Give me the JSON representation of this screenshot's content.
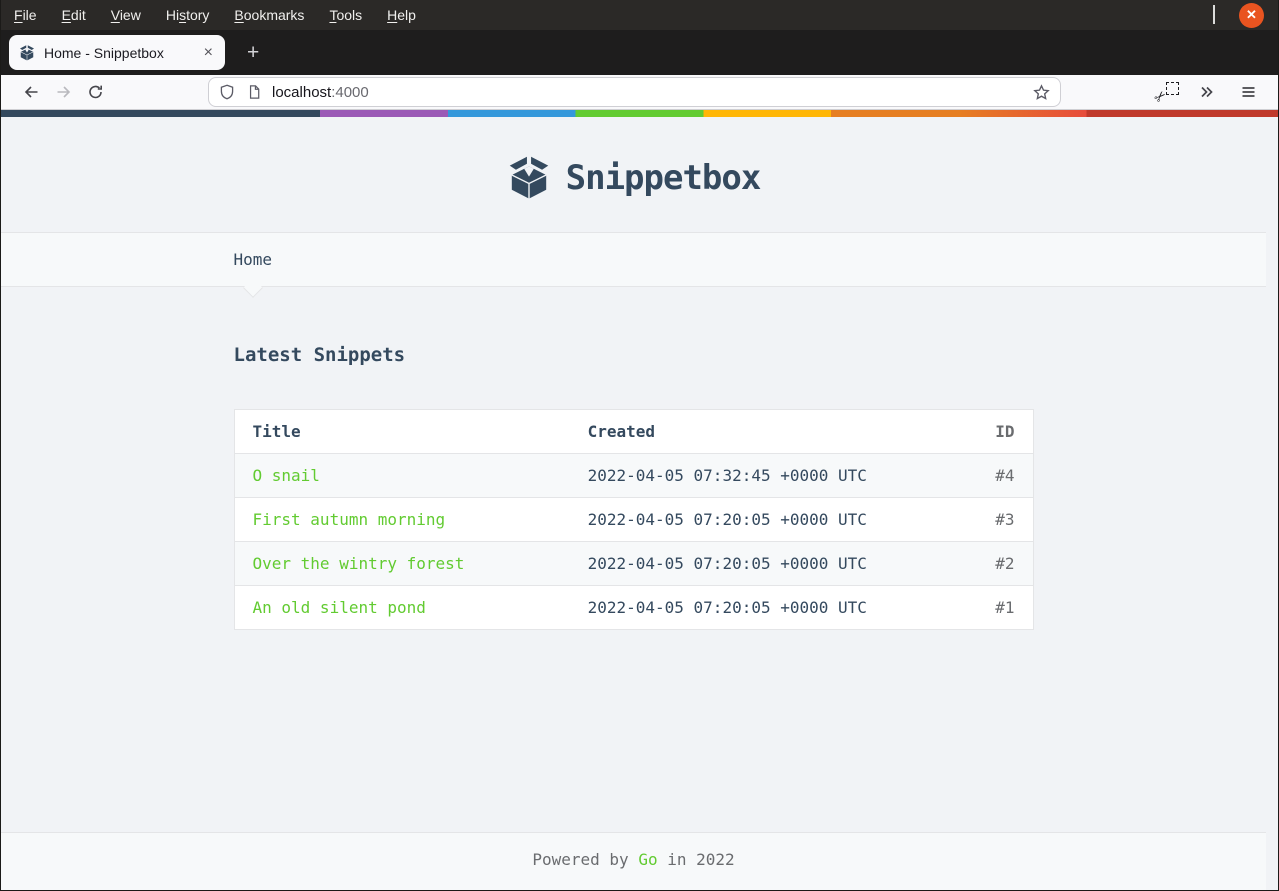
{
  "menubar": {
    "items": [
      {
        "pre": "",
        "key": "F",
        "post": "ile"
      },
      {
        "pre": "",
        "key": "E",
        "post": "dit"
      },
      {
        "pre": "",
        "key": "V",
        "post": "iew"
      },
      {
        "pre": "Hi",
        "key": "s",
        "post": "tory"
      },
      {
        "pre": "",
        "key": "B",
        "post": "ookmarks"
      },
      {
        "pre": "",
        "key": "T",
        "post": "ools"
      },
      {
        "pre": "",
        "key": "H",
        "post": "elp"
      }
    ]
  },
  "window_controls": {
    "close_glyph": "✕"
  },
  "tabbar": {
    "tab_title": "Home - Snippetbox",
    "close_glyph": "×",
    "new_tab_glyph": "+"
  },
  "toolbar": {
    "url_host": "localhost",
    "url_port": ":4000",
    "screenshot_glyph": "✂"
  },
  "page": {
    "brand": "Snippetbox",
    "nav": {
      "home_label": "Home"
    },
    "heading": "Latest Snippets",
    "table": {
      "headers": {
        "title": "Title",
        "created": "Created",
        "id": "ID"
      },
      "rows": [
        {
          "title": "O snail",
          "created": "2022-04-05 07:32:45 +0000 UTC",
          "id": "#4"
        },
        {
          "title": "First autumn morning",
          "created": "2022-04-05 07:20:05 +0000 UTC",
          "id": "#3"
        },
        {
          "title": "Over the wintry forest",
          "created": "2022-04-05 07:20:05 +0000 UTC",
          "id": "#2"
        },
        {
          "title": "An old silent pond",
          "created": "2022-04-05 07:20:05 +0000 UTC",
          "id": "#1"
        }
      ]
    },
    "footer": {
      "pre": "Powered by ",
      "link": "Go",
      "post": " in 2022"
    }
  },
  "colors": {
    "accent_green": "#62CB31",
    "navy": "#34495E",
    "muted": "#6A6C6F",
    "body_bg": "#F1F3F6",
    "band_bg": "#F7F9FA",
    "border": "#E4E5E7",
    "ubuntu_orange": "#E95420",
    "stripe": [
      "#34495E",
      "#9B59B6",
      "#3498DB",
      "#62CB31",
      "#FFB606",
      "#E67E22",
      "#E74C3C",
      "#C0392B"
    ]
  }
}
